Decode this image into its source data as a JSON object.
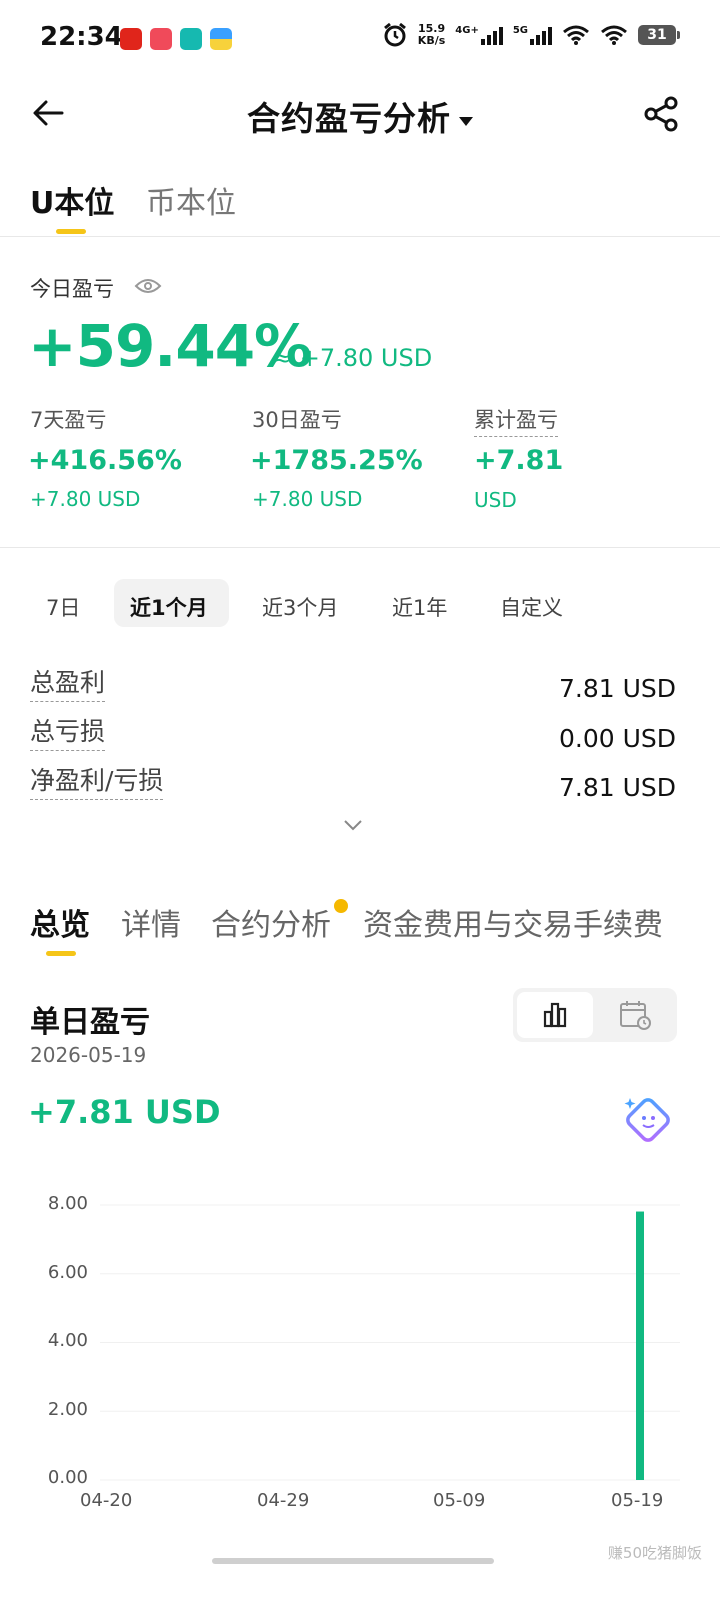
{
  "status_bar": {
    "time": "22:34",
    "net_speed_value": "15.9",
    "net_speed_unit": "KB/s",
    "signal1_label": "4G+",
    "signal2_label": "5G",
    "battery": "31"
  },
  "header": {
    "title": "合约盈亏分析"
  },
  "unit_tabs": [
    {
      "label": "U本位",
      "active": true
    },
    {
      "label": "币本位",
      "active": false
    }
  ],
  "today": {
    "label": "今日盈亏",
    "percent": "+59.44%",
    "approx": "≈ +7.80 USD"
  },
  "stats": [
    {
      "label": "7天盈亏",
      "value": "+416.56%",
      "sub": "+7.80 USD"
    },
    {
      "label": "30日盈亏",
      "value": "+1785.25%",
      "sub": "+7.80 USD"
    },
    {
      "label": "累计盈亏",
      "value": "+7.81",
      "sub": "USD"
    }
  ],
  "periods": [
    "7日",
    "近1个月",
    "近3个月",
    "近1年",
    "自定义"
  ],
  "summary": [
    {
      "label": "总盈利",
      "value": "7.81 USD"
    },
    {
      "label": "总亏损",
      "value": "0.00 USD"
    },
    {
      "label": "净盈利/亏损",
      "value": "7.81 USD"
    }
  ],
  "section_tabs": [
    "总览",
    "详情",
    "合约分析",
    "资金费用与交易手续费"
  ],
  "daily": {
    "title": "单日盈亏",
    "date": "2026-05-19",
    "value": "+7.81 USD"
  },
  "colors": {
    "green": "#11b981",
    "accent_yellow": "#f5c518",
    "dot": "#f5b800"
  },
  "chart_data": {
    "type": "bar",
    "x_ticks": [
      "04-20",
      "04-29",
      "05-09",
      "05-19"
    ],
    "y_ticks": [
      "0.00",
      "2.00",
      "4.00",
      "6.00",
      "8.00"
    ],
    "ylim": [
      0,
      8
    ],
    "grid": true,
    "categories": [
      "04-20",
      "04-21",
      "04-22",
      "04-23",
      "04-24",
      "04-25",
      "04-26",
      "04-27",
      "04-28",
      "04-29",
      "04-30",
      "05-01",
      "05-02",
      "05-03",
      "05-04",
      "05-05",
      "05-06",
      "05-07",
      "05-08",
      "05-09",
      "05-10",
      "05-11",
      "05-12",
      "05-13",
      "05-14",
      "05-15",
      "05-16",
      "05-17",
      "05-18",
      "05-19"
    ],
    "values": [
      0,
      0,
      0,
      0,
      0,
      0,
      0,
      0,
      0,
      0,
      0,
      0,
      0,
      0,
      0,
      0,
      0,
      0,
      0,
      0,
      0,
      0,
      0,
      0,
      0,
      0,
      0,
      0,
      0,
      7.81
    ],
    "bar_color": "#11b981"
  },
  "watermark": "赚50吃猪脚饭"
}
